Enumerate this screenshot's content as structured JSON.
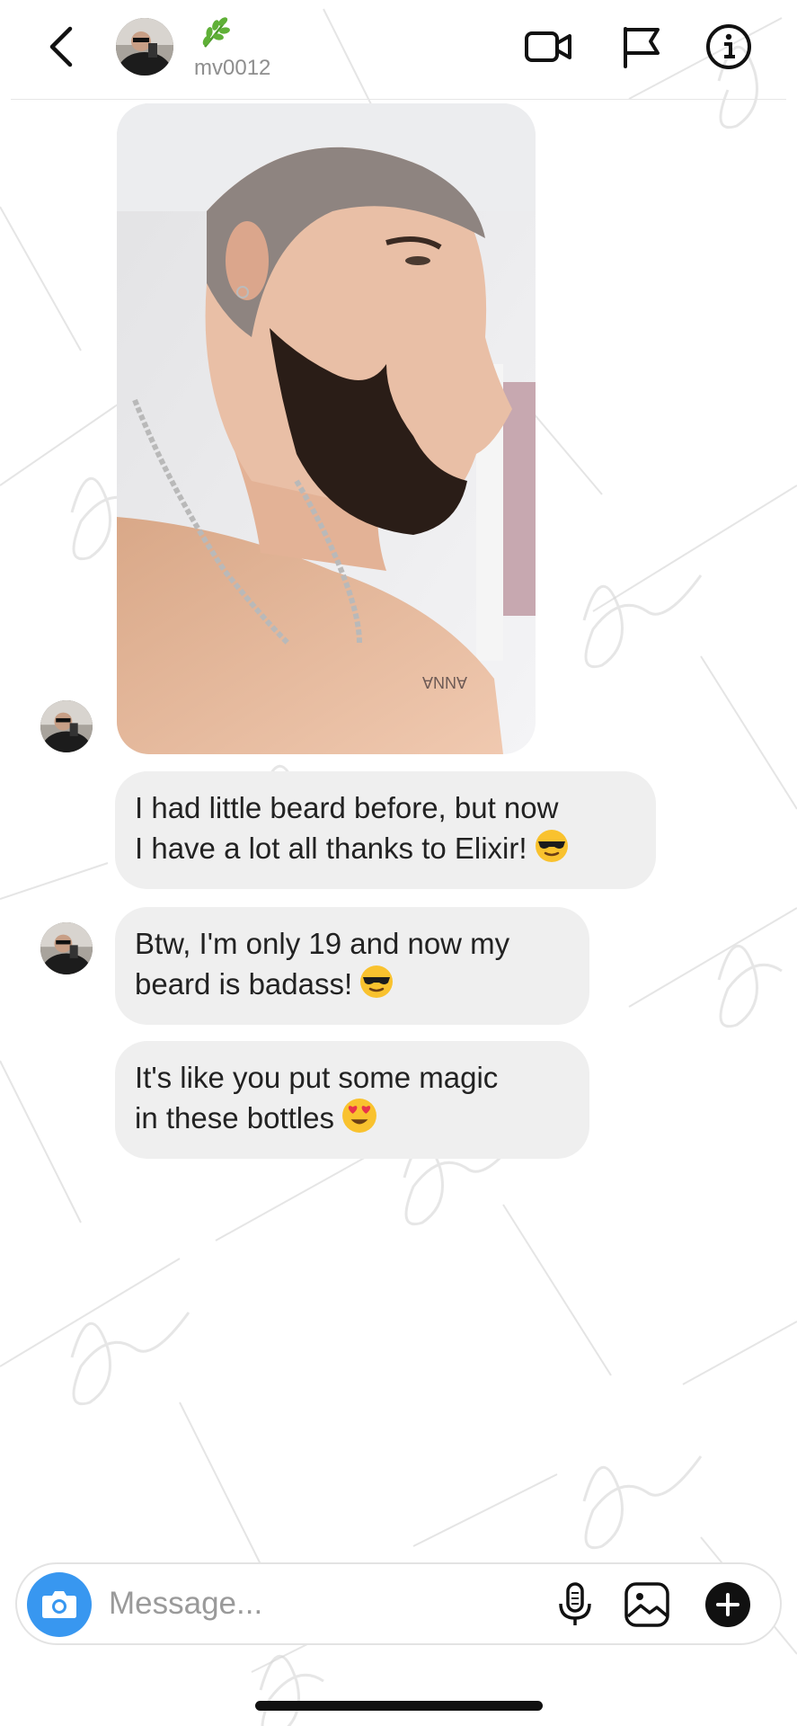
{
  "header": {
    "username": "mv0012",
    "back_icon": "chevron-left-icon",
    "video_icon": "video-camera-icon",
    "report_icon": "flag-icon",
    "info_icon": "info-icon",
    "badge_icon": "leaf-icon"
  },
  "messages": [
    {
      "text_line1": "I had little beard before, but now",
      "text_line2": "I have a lot all thanks to Elixir!",
      "emoji": "sunglasses-emoji"
    },
    {
      "text_line1": "Btw, I'm only 19 and now my",
      "text_line2": "beard is badass!",
      "emoji": "sunglasses-emoji"
    },
    {
      "text_line1": "It's like you put some magic",
      "text_line2": "in these bottles",
      "emoji": "heart-eyes-emoji"
    }
  ],
  "photo": {
    "tattoo_text": "ANNA"
  },
  "composer": {
    "placeholder": "Message...",
    "camera_icon": "camera-icon",
    "mic_icon": "microphone-icon",
    "gallery_icon": "image-icon",
    "add_icon": "plus-icon"
  },
  "colors": {
    "accent": "#3897f0",
    "bubble": "#efefef",
    "meta": "#8e8e8e"
  }
}
